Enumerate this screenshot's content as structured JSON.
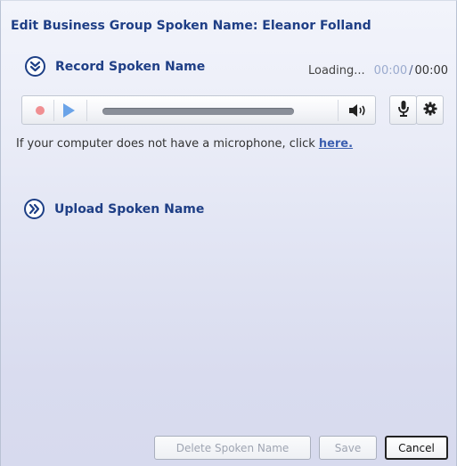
{
  "dialog": {
    "title": "Edit Business Group Spoken Name: Eleanor Folland"
  },
  "record": {
    "header_label": "Record Spoken Name",
    "header_icon": "chevron-double-down-icon",
    "status_text": "Loading...",
    "current_time": "00:00",
    "time_separator": "/",
    "total_time": "00:00"
  },
  "player": {
    "record_icon": "record-icon",
    "play_icon": "play-icon",
    "volume_icon": "speaker-icon",
    "mic_icon": "microphone-icon",
    "settings_icon": "gear-icon",
    "progress": 0
  },
  "hint": {
    "text": "If your computer does not have a microphone, click",
    "link": "here."
  },
  "upload": {
    "header_label": "Upload Spoken Name",
    "header_icon": "chevron-double-right-icon"
  },
  "footer": {
    "delete_label": "Delete Spoken Name",
    "save_label": "Save",
    "cancel_label": "Cancel"
  },
  "colors": {
    "heading": "#1f3f86",
    "link": "#3c5fb0",
    "record_dot": "#f08f92",
    "play": "#6aa3e8",
    "current_time": "#9aaace"
  }
}
